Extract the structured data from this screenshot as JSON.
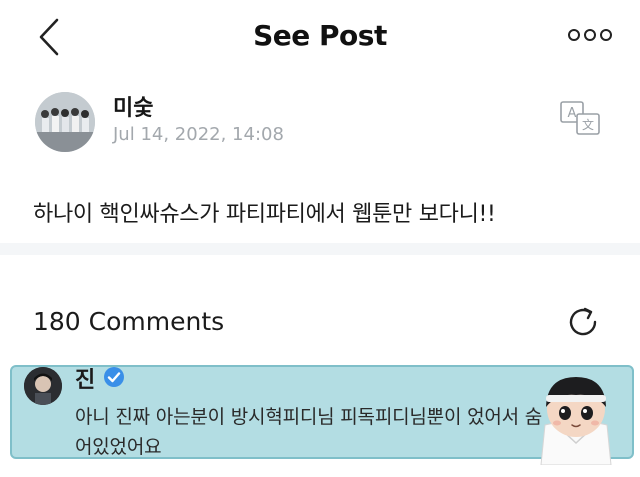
{
  "header": {
    "title": "See Post",
    "back_icon": "chevron-left-icon",
    "more_icon": "more-dots-icon"
  },
  "post": {
    "author": "미숯",
    "timestamp": "Jul 14, 2022, 14:08",
    "body": "하나이 핵인싸슈스가 파티파티에서 웹툰만 보다니!!",
    "translate_icon": "translate-icon"
  },
  "comments": {
    "count_label": "180 Comments",
    "refresh_icon": "refresh-icon",
    "items": [
      {
        "author": "진",
        "verified": true,
        "text": "아니 진짜 아는분이 방시혁피디님 피독피디님뿐이 었어서 숨어있었어요"
      }
    ]
  },
  "colors": {
    "comment_highlight": "#b3dde3",
    "verified_blue": "#3a8fe8",
    "timestamp_gray": "#a3a8ad",
    "divider": "#f4f6f8"
  }
}
